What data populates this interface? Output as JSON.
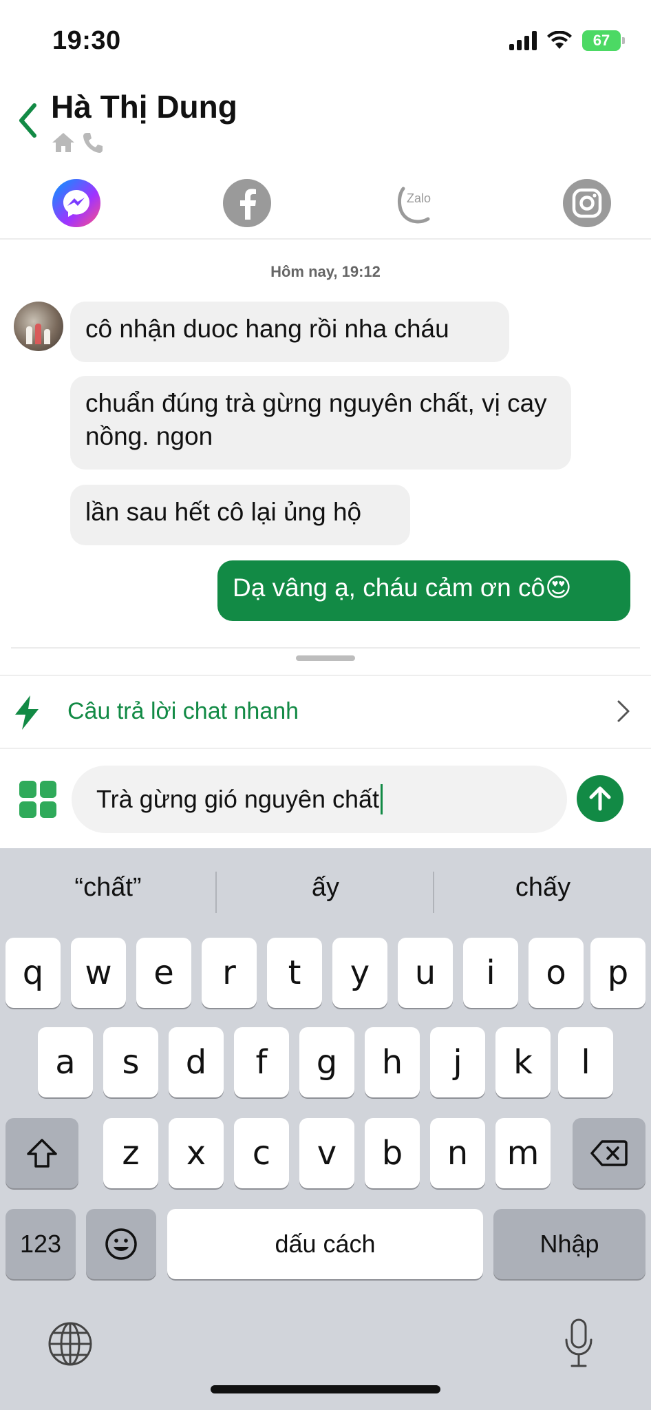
{
  "status_bar": {
    "time": "19:30",
    "battery": "67"
  },
  "header": {
    "contact_name": "Hà Thị Dung"
  },
  "social": {
    "zalo_label": "Zalo"
  },
  "chat": {
    "date_label": "Hôm nay, 19:12",
    "messages": [
      {
        "direction": "in",
        "text": "cô nhận duoc hang rồi nha cháu"
      },
      {
        "direction": "in",
        "text": "chuẩn đúng trà gừng nguyên chất, vị cay nồng. ngon"
      },
      {
        "direction": "in",
        "text": "lần sau hết cô lại ủng hộ"
      },
      {
        "direction": "out",
        "text": "Dạ vâng ạ, cháu cảm ơn cô😍"
      }
    ]
  },
  "quick_reply": {
    "label": "Câu trả lời chat nhanh"
  },
  "compose": {
    "text": "Trà gừng gió nguyên chất"
  },
  "keyboard": {
    "suggestions": [
      "“chất”",
      "ấy",
      "chấy"
    ],
    "row1": [
      "q",
      "w",
      "e",
      "r",
      "t",
      "y",
      "u",
      "i",
      "o",
      "p"
    ],
    "row2": [
      "a",
      "s",
      "d",
      "f",
      "g",
      "h",
      "j",
      "k",
      "l"
    ],
    "row3": [
      "z",
      "x",
      "c",
      "v",
      "b",
      "n",
      "m"
    ],
    "numbers_label": "123",
    "space_label": "dấu cách",
    "return_label": "Nhập"
  },
  "colors": {
    "accent": "#128a45",
    "keyboard_bg": "#d1d4da",
    "incoming_bubble": "#f0f0f0"
  },
  "icons": [
    "back-chevron-icon",
    "home-icon",
    "phone-icon",
    "messenger-icon",
    "facebook-icon",
    "zalo-icon",
    "instagram-icon",
    "lightning-icon",
    "chevron-right-icon",
    "apps-grid-icon",
    "send-arrow-icon",
    "shift-icon",
    "backspace-icon",
    "emoji-icon",
    "globe-icon",
    "microphone-icon"
  ]
}
